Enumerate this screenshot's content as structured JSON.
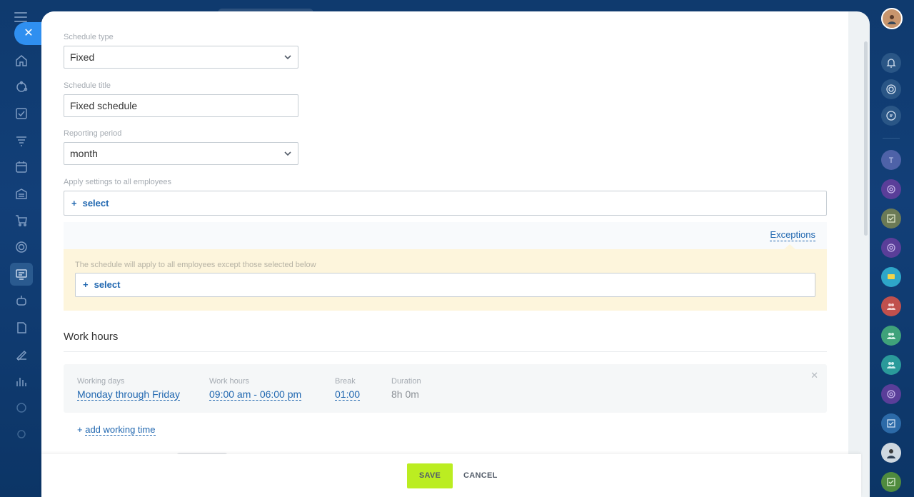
{
  "form": {
    "schedule_type": {
      "label": "Schedule type",
      "value": "Fixed"
    },
    "schedule_title": {
      "label": "Schedule title",
      "value": "Fixed schedule"
    },
    "reporting_period": {
      "label": "Reporting period",
      "value": "month"
    },
    "apply_settings": {
      "label": "Apply settings to all employees",
      "select_label": "select"
    },
    "exceptions": {
      "link_label": "Exceptions",
      "note": "The schedule will apply to all employees except those selected below",
      "select_label": "select"
    }
  },
  "work_hours": {
    "title": "Work hours",
    "row": {
      "working_days_label": "Working days",
      "working_days_value": "Monday through Friday",
      "work_hours_label": "Work hours",
      "work_hours_value": "09:00 am - 06:00 pm",
      "break_label": "Break",
      "break_value": "01:00",
      "duration_label": "Duration",
      "duration_value": "8h 0m"
    },
    "add_label": "add working time"
  },
  "footer": {
    "save_label": "SAVE",
    "cancel_label": "CANCEL"
  },
  "colors": {
    "accent": "#2067b0",
    "save": "#bbed21",
    "close": "#2f8ff0",
    "warning_bg": "#fdf5dc"
  }
}
